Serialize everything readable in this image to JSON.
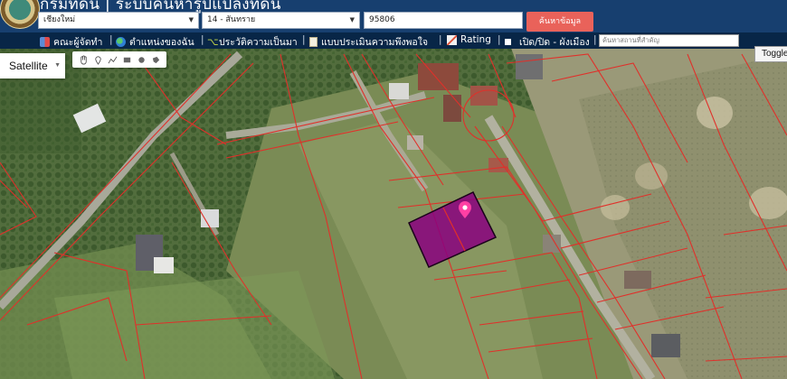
{
  "header": {
    "title": "กรมที่ดิน | ระบบค้นหารูปแปลงที่ดิน",
    "province_select": "เชียงใหม่",
    "district_select": "14 - สันทราย",
    "parcel_number": "95806",
    "search_button": "ค้นหาข้อมูล"
  },
  "nav": {
    "items": [
      {
        "label": "คณะผู้จัดทำ",
        "icon": "team-icon"
      },
      {
        "label": "ตำแหน่งของฉัน",
        "icon": "globe-icon"
      },
      {
        "label": "ประวัติความเป็นมา",
        "icon": "sprout-icon"
      },
      {
        "label": "แบบประเมินความพึงพอใจ",
        "icon": "document-icon"
      },
      {
        "label": "Rating",
        "icon": "chart-icon"
      },
      {
        "label": "เปิด/ปิด - ผังเมือง",
        "icon": "square-icon"
      }
    ],
    "place_search_placeholder": "ค้นหาสถานที่สำคัญ"
  },
  "map": {
    "type_label": "Satellite",
    "toggle_label": "Toggle",
    "draw_tools": [
      "hand-icon",
      "marker-icon",
      "polyline-icon",
      "rectangle-icon",
      "circle-icon",
      "polygon-icon"
    ],
    "highlight_color": "#8a007f",
    "boundary_color": "#e0302a",
    "marker_color": "#ff3fa4"
  }
}
